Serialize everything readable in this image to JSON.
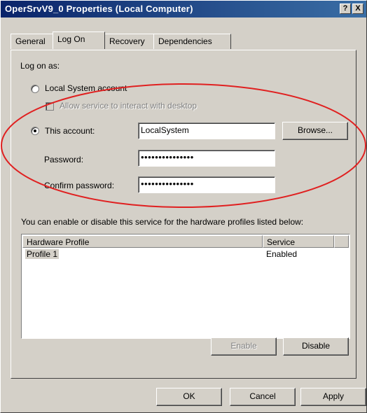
{
  "window": {
    "title": "OperSrvV9_0 Properties (Local Computer)",
    "help_label": "?",
    "close_label": "X"
  },
  "tabs": [
    {
      "label": "General",
      "active": false
    },
    {
      "label": "Log On",
      "active": true
    },
    {
      "label": "Recovery",
      "active": false
    },
    {
      "label": "Dependencies",
      "active": false
    }
  ],
  "logon": {
    "heading": "Log on as:",
    "local_system_label": "Local System account",
    "interact_desktop_label": "Allow service to interact with desktop",
    "this_account_label": "This account:",
    "selected": "this_account",
    "account_value": "LocalSystem",
    "browse_label": "Browse...",
    "password_label": "Password:",
    "password_value": "•••••••••••••••",
    "confirm_label": "Confirm password:",
    "confirm_value": "•••••••••••••••"
  },
  "profiles": {
    "description": "You can enable or disable this service for the hardware profiles listed below:",
    "columns": [
      "Hardware Profile",
      "Service"
    ],
    "rows": [
      {
        "profile": "Profile 1",
        "service": "Enabled"
      }
    ],
    "enable_label": "Enable",
    "disable_label": "Disable"
  },
  "footer": {
    "ok_label": "OK",
    "cancel_label": "Cancel",
    "apply_label": "Apply"
  },
  "annotation_color": "#e02020"
}
